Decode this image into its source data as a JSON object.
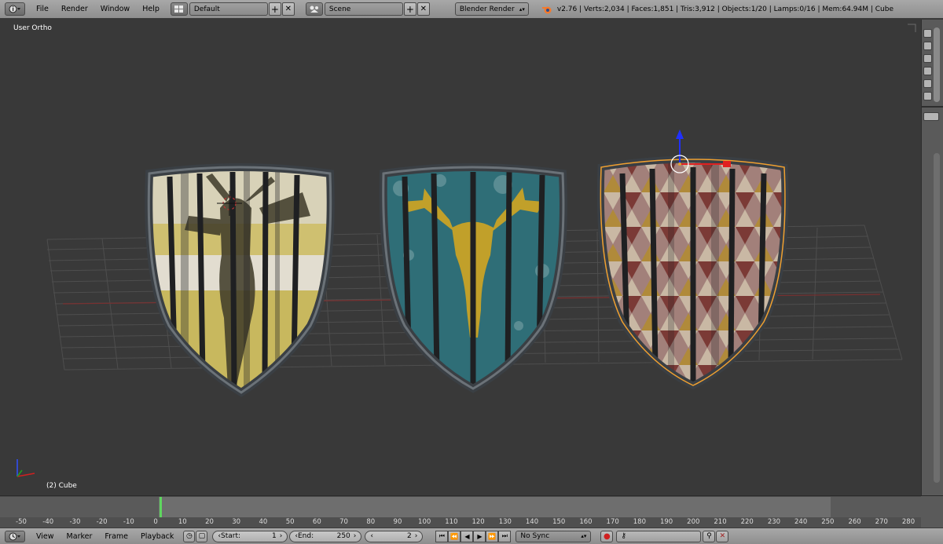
{
  "header": {
    "menus": [
      "File",
      "Render",
      "Window",
      "Help"
    ],
    "layout": "Default",
    "scene": "Scene",
    "render_engine": "Blender Render",
    "stats": "v2.76 | Verts:2,034 | Faces:1,851 | Tris:3,912 | Objects:1/20 | Lamps:0/16 | Mem:64.94M | Cube"
  },
  "viewport": {
    "view_label": "User Ortho",
    "object_label": "(2) Cube"
  },
  "timeline": {
    "ticks": [
      "-50",
      "-40",
      "-30",
      "-20",
      "-10",
      "0",
      "10",
      "20",
      "30",
      "40",
      "50",
      "60",
      "70",
      "80",
      "90",
      "100",
      "110",
      "120",
      "130",
      "140",
      "150",
      "160",
      "170",
      "180",
      "190",
      "200",
      "210",
      "220",
      "230",
      "240",
      "250",
      "260",
      "270",
      "280"
    ],
    "current_frame_fraction": 0.015
  },
  "bottom": {
    "menus": [
      "View",
      "Marker",
      "Frame",
      "Playback"
    ],
    "start_label": "Start:",
    "start_value": "1",
    "end_label": "End:",
    "end_value": "250",
    "current_value": "2",
    "sync": "No Sync"
  },
  "colors": {
    "viewport_bg": "#393939",
    "header_bg": "#999999",
    "selection_outline": "#f0a030",
    "frame_marker": "#5fd65f"
  }
}
